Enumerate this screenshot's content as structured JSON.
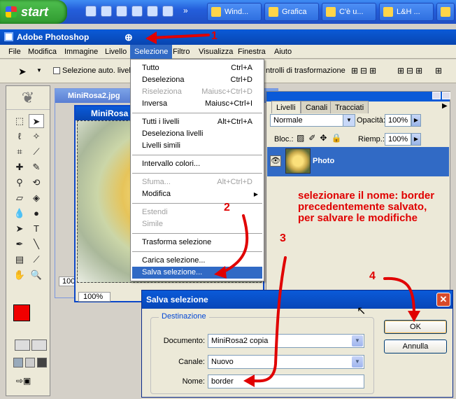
{
  "taskbar": {
    "start_label": "start",
    "buttons": [
      {
        "label": "Wind..."
      },
      {
        "label": "Grafica"
      },
      {
        "label": "C'è u..."
      },
      {
        "label": "L&H ..."
      },
      {
        "label": "F"
      }
    ]
  },
  "app": {
    "title": "Adobe Photoshop",
    "menus": [
      "File",
      "Modifica",
      "Immagine",
      "Livello",
      "Selezione",
      "Filtro",
      "Visualizza",
      "Finestra",
      "Aiuto"
    ],
    "options_bar": {
      "auto_select_label": "Selezione auto. livello",
      "transform_label": "ntrolli di trasformazione"
    }
  },
  "documents": {
    "back_title": "MiniRosa2.jpg",
    "front_title": "MiniRosa",
    "front_zoom": "100%",
    "back_zoom": "100%"
  },
  "layers_panel": {
    "tabs": [
      "Livelli",
      "Canali",
      "Tracciati"
    ],
    "blend_mode": "Normale",
    "opacity_label": "Opacità:",
    "opacity_value": "100%",
    "lock_label": "Bloc.:",
    "fill_label": "Riemp.:",
    "fill_value": "100%",
    "layer_name": "Photo"
  },
  "selection_menu": {
    "items": [
      {
        "label": "Tutto",
        "shortcut": "Ctrl+A",
        "disabled": false
      },
      {
        "label": "Deseleziona",
        "shortcut": "Ctrl+D",
        "disabled": false
      },
      {
        "label": "Riseleziona",
        "shortcut": "Maiusc+Ctrl+D",
        "disabled": true
      },
      {
        "label": "Inversa",
        "shortcut": "Maiusc+Ctrl+I",
        "disabled": false
      },
      {
        "label": "Tutti i livelli",
        "shortcut": "Alt+Ctrl+A",
        "disabled": false
      },
      {
        "label": "Deseleziona livelli",
        "shortcut": "",
        "disabled": false
      },
      {
        "label": "Livelli simili",
        "shortcut": "",
        "disabled": false
      },
      {
        "label": "Intervallo colori...",
        "shortcut": "",
        "disabled": false
      },
      {
        "label": "Sfuma...",
        "shortcut": "Alt+Ctrl+D",
        "disabled": true
      },
      {
        "label": "Modifica",
        "shortcut": "",
        "disabled": false
      },
      {
        "label": "Estendi",
        "shortcut": "",
        "disabled": true
      },
      {
        "label": "Simile",
        "shortcut": "",
        "disabled": true
      },
      {
        "label": "Trasforma selezione",
        "shortcut": "",
        "disabled": false
      },
      {
        "label": "Carica selezione...",
        "shortcut": "",
        "disabled": false
      },
      {
        "label": "Salva selezione...",
        "shortcut": "",
        "disabled": false
      }
    ]
  },
  "dialog": {
    "title": "Salva selezione",
    "group_label": "Destinazione",
    "document_label": "Documento:",
    "document_value": "MiniRosa2 copia",
    "channel_label": "Canale:",
    "channel_value": "Nuovo",
    "name_label": "Nome:",
    "name_value": "border",
    "ok_label": "OK",
    "cancel_label": "Annulla"
  },
  "annotations": {
    "n1": "1",
    "n2": "2",
    "n3": "3",
    "n4": "4",
    "note": "selezionare il nome: border precedentemente salvato, per salvare le modifiche"
  },
  "colors": {
    "annotation": "#e00000",
    "xp_blue": "#0a5ad8",
    "highlight": "#316ac5"
  }
}
